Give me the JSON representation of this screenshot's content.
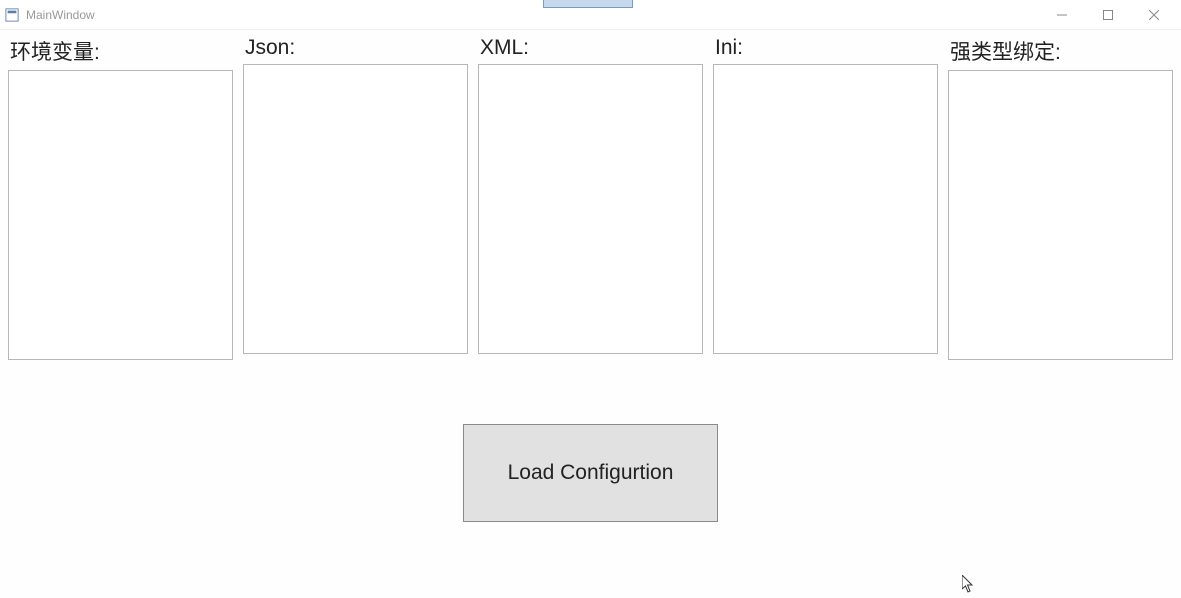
{
  "window": {
    "title": "MainWindow"
  },
  "columns": [
    {
      "label": "环境变量:",
      "content": ""
    },
    {
      "label": "Json:",
      "content": ""
    },
    {
      "label": "XML:",
      "content": ""
    },
    {
      "label": "Ini:",
      "content": ""
    },
    {
      "label": "强类型绑定:",
      "content": ""
    }
  ],
  "button": {
    "load_label": "Load Configurtion"
  }
}
